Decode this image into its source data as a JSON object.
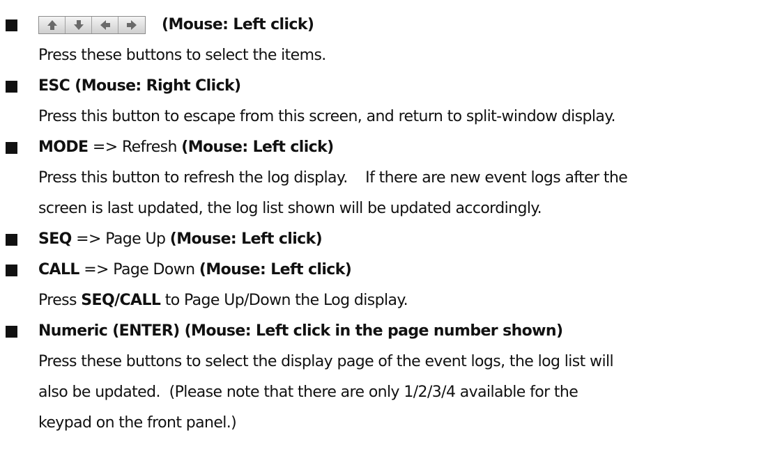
{
  "items": [
    {
      "heading_suffix": "(Mouse: Left click)",
      "icons": [
        "up-arrow-icon",
        "down-arrow-icon",
        "left-arrow-icon",
        "right-arrow-icon"
      ],
      "desc": "Press these buttons to select the items."
    },
    {
      "heading": "ESC (Mouse: Right Click)",
      "desc": "Press this button to escape from this screen, and return to split-window display."
    },
    {
      "key": "MODE",
      "action": " => Refresh ",
      "mouse": "(Mouse: Left click)",
      "desc_line1": "Press this button to refresh the log display.    If there are new event logs after the",
      "desc_line2": "screen is last updated, the log list shown will be updated accordingly."
    },
    {
      "key": "SEQ",
      "action": " => Page Up ",
      "mouse": "(Mouse: Left click)"
    },
    {
      "key": "CALL",
      "action": " => Page Down ",
      "mouse": "(Mouse: Left click)",
      "desc_pre": "Press ",
      "desc_bold": "SEQ/CALL",
      "desc_post": " to Page Up/Down the Log display."
    },
    {
      "heading": "Numeric (ENTER) (Mouse: Left click in the page number shown)",
      "desc_line1": "Press these buttons to select the display page of the event logs, the log list will",
      "desc_line2": "also be updated.  (Please note that there are only 1/2/3/4 available for the",
      "desc_line3": "keypad on the front panel.)"
    }
  ]
}
